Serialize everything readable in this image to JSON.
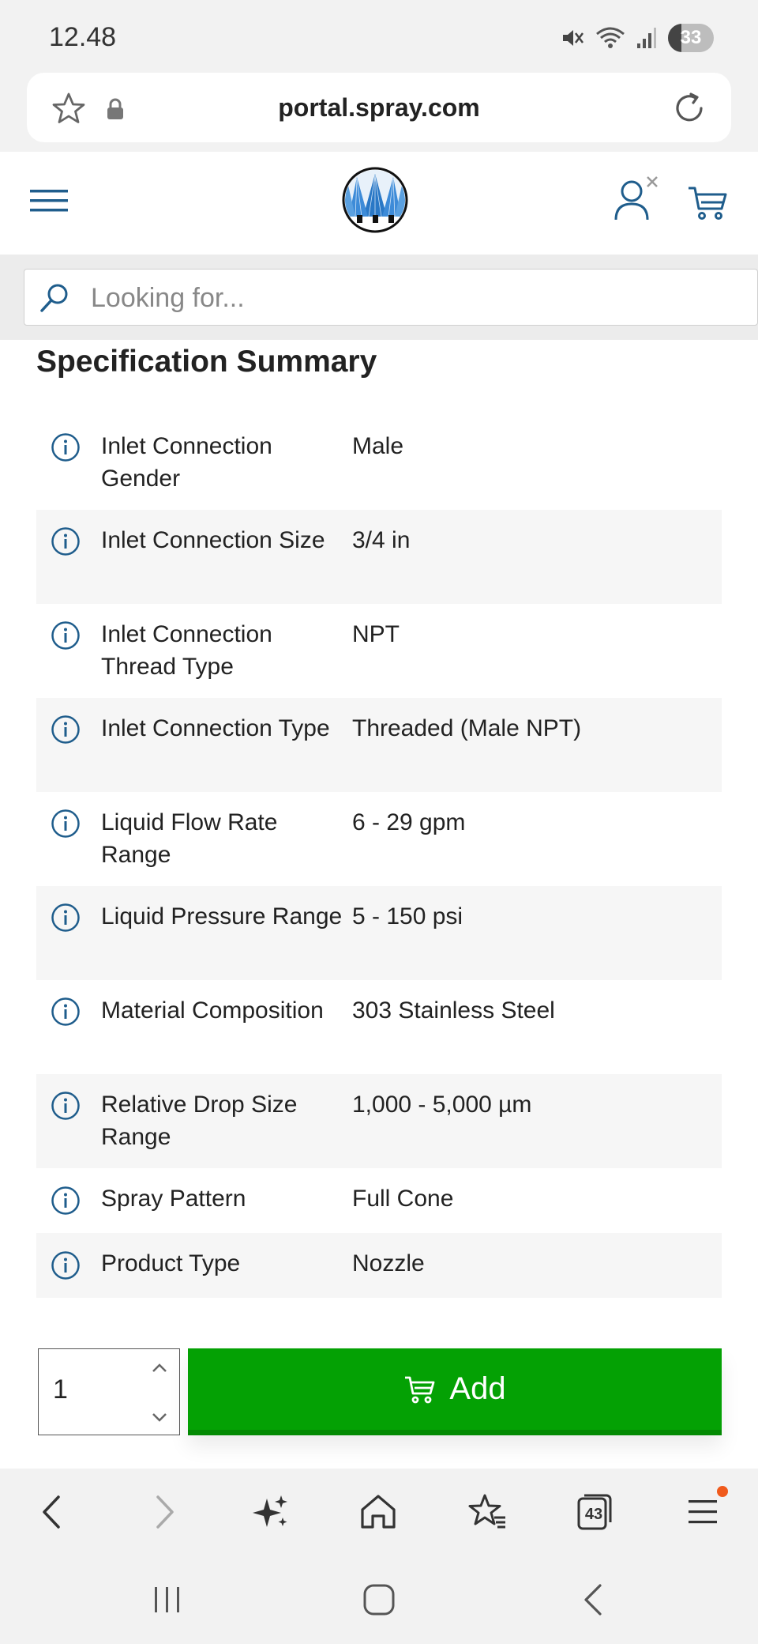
{
  "status_bar": {
    "time": "12.48",
    "battery": "33",
    "icons": [
      "mute-icon",
      "wifi-icon",
      "signal-icon",
      "battery-icon"
    ]
  },
  "browser": {
    "url": "portal.spray.com",
    "tabs_count": "43"
  },
  "search": {
    "placeholder": "Looking for..."
  },
  "section_title": "Specification Summary",
  "specs": [
    {
      "label": "Inlet Connection Gender",
      "value": "Male"
    },
    {
      "label": "Inlet Connection Size",
      "value": "3/4 in"
    },
    {
      "label": "Inlet Connection Thread Type",
      "value": "NPT"
    },
    {
      "label": "Inlet Connection Type",
      "value": "Threaded (Male NPT)"
    },
    {
      "label": "Liquid Flow Rate Range",
      "value": "6 - 29 gpm"
    },
    {
      "label": "Liquid Pressure Range",
      "value": "5 - 150 psi"
    },
    {
      "label": "Material Composition",
      "value": "303 Stainless Steel"
    },
    {
      "label": "Relative Drop Size Range",
      "value": "1,000 - 5,000 µm"
    },
    {
      "label": "Spray Pattern",
      "value": "Full Cone"
    },
    {
      "label": "Product Type",
      "value": "Nozzle"
    }
  ],
  "cart": {
    "quantity": "1",
    "add_label": "Add"
  },
  "colors": {
    "brand_blue": "#1f5d8c",
    "add_green": "#04a104",
    "notification_orange": "#f05a1c"
  }
}
